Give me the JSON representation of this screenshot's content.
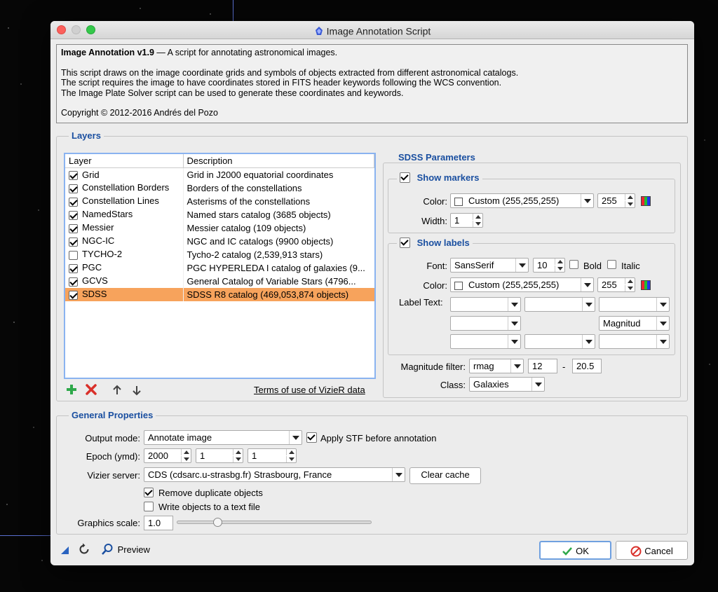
{
  "window": {
    "title": "Image Annotation Script"
  },
  "info": {
    "heading": "Image Annotation v1.9",
    "heading_suffix": " — A script for annotating astronomical images.",
    "line1": "This script draws on the image coordinate grids and symbols of objects extracted from different astronomical catalogs.",
    "line2": "The script requires the image to have coordinates stored in FITS header keywords following the WCS convention.",
    "line3": "The Image Plate Solver script can be used to generate these coordinates and keywords.",
    "copyright": "Copyright © 2012-2016 Andrés del Pozo"
  },
  "layers": {
    "title": "Layers",
    "columns": [
      "Layer",
      "Description"
    ],
    "rows": [
      {
        "name": "Grid",
        "desc": "Grid in J2000 equatorial coordinates",
        "checked": true,
        "selected": false
      },
      {
        "name": "Constellation Borders",
        "desc": "Borders of the constellations",
        "checked": true,
        "selected": false
      },
      {
        "name": "Constellation Lines",
        "desc": "Asterisms of the constellations",
        "checked": true,
        "selected": false
      },
      {
        "name": "NamedStars",
        "desc": "Named stars catalog (3685 objects)",
        "checked": true,
        "selected": false
      },
      {
        "name": "Messier",
        "desc": "Messier catalog (109 objects)",
        "checked": true,
        "selected": false
      },
      {
        "name": "NGC-IC",
        "desc": "NGC and IC catalogs (9900 objects)",
        "checked": true,
        "selected": false
      },
      {
        "name": "TYCHO-2",
        "desc": "Tycho-2 catalog (2,539,913 stars)",
        "checked": false,
        "selected": false
      },
      {
        "name": "PGC",
        "desc": "PGC HYPERLEDA I catalog of galaxies (9...",
        "checked": true,
        "selected": false
      },
      {
        "name": "GCVS",
        "desc": "General Catalog of Variable Stars (4796...",
        "checked": true,
        "selected": false
      },
      {
        "name": "SDSS",
        "desc": "SDSS R8 catalog (469,053,874 objects)",
        "checked": true,
        "selected": true
      }
    ],
    "terms_link": "Terms of use of VizieR data"
  },
  "sdss": {
    "title": "SDSS Parameters",
    "markers": {
      "label": "Show markers",
      "checked": true,
      "color_label": "Color:",
      "color_value": "Custom (255,255,255)",
      "alpha": "255",
      "width_label": "Width:",
      "width": "1"
    },
    "labels": {
      "label": "Show labels",
      "checked": true,
      "font_label": "Font:",
      "font": "SansSerif",
      "size": "10",
      "bold": "Bold",
      "italic": "Italic",
      "color_label": "Color:",
      "color_value": "Custom (255,255,255)",
      "alpha": "255",
      "text_label": "Label Text:",
      "magnitud": "Magnitud"
    },
    "magfilter_label": "Magnitude filter:",
    "mag_band": "rmag",
    "mag_min": "12",
    "mag_sep": "-",
    "mag_max": "20.5",
    "class_label": "Class:",
    "class_value": "Galaxies"
  },
  "general": {
    "title": "General Properties",
    "output_label": "Output mode:",
    "output_value": "Annotate image",
    "apply_stf": "Apply STF before annotation",
    "epoch_label": "Epoch (ymd):",
    "epoch_y": "2000",
    "epoch_m": "1",
    "epoch_d": "1",
    "vizier_label": "Vizier server:",
    "vizier_value": "CDS (cdsarc.u-strasbg.fr) Strasbourg, France",
    "clear_cache": "Clear cache",
    "remove_dup": "Remove duplicate objects",
    "write_objects": "Write objects to a text file",
    "scale_label": "Graphics scale:",
    "scale_value": "1.0"
  },
  "footer": {
    "preview": "Preview",
    "ok": "OK",
    "cancel": "Cancel"
  },
  "colors": {
    "accent": "#1a4fa0",
    "selection": "#f7a35c",
    "ok_border": "#6fa0e0"
  }
}
